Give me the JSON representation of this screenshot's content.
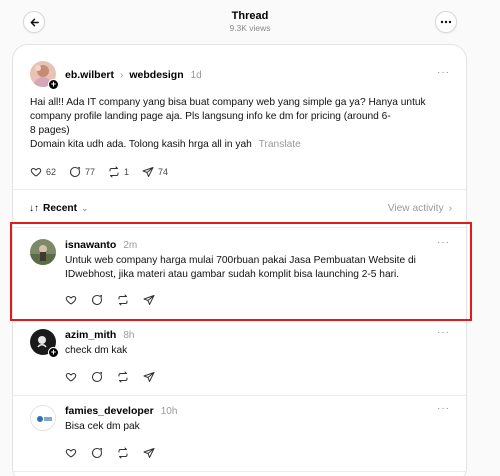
{
  "header": {
    "title": "Thread",
    "views": "9.3K views"
  },
  "post": {
    "username": "eb.wilbert",
    "community": "webdesign",
    "time": "1d",
    "lines": [
      "Hai all!! Ada IT company yang bisa buat company web yang simple ga ya? Hanya untuk",
      "company profile landing page aja. Pls langsung info ke dm for pricing (around 6-",
      "8 pages)"
    ],
    "last_line": "Domain kita udh ada. Tolong kasih hrga all in yah",
    "translate": "Translate",
    "likes": "62",
    "comments": "77",
    "reposts": "1",
    "shares": "74"
  },
  "sort": {
    "label": "Recent",
    "view_activity": "View activity"
  },
  "replies": [
    {
      "username": "isnawanto",
      "time": "2m",
      "lines": [
        "Untuk web company harga mulai 700rbuan pakai Jasa Pembuatan Website di",
        "IDwebhost, jika materi atau gambar sudah komplit bisa launching 2-5 hari."
      ]
    },
    {
      "username": "azim_mith",
      "time": "8h",
      "lines": [
        "check dm kak"
      ]
    },
    {
      "username": "famies_developer",
      "time": "10h",
      "lines": [
        "Bisa cek dm pak"
      ]
    }
  ],
  "colors": {
    "background": "#fafafa",
    "card": "#ffffff",
    "highlight": "#e01b1b",
    "muted": "#9a9a9a"
  }
}
